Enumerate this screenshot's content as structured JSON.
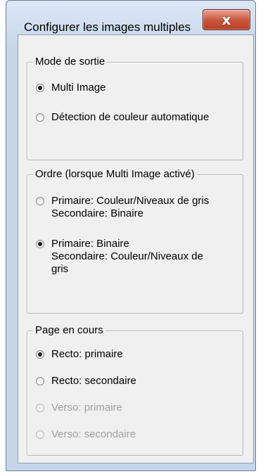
{
  "window": {
    "title": "Configurer les images multiples",
    "close_icon": "x"
  },
  "output_mode": {
    "legend": "Mode de sortie",
    "options": [
      {
        "label": "Multi Image",
        "checked": true,
        "disabled": false
      },
      {
        "label": "Détection de couleur automatique",
        "checked": false,
        "disabled": false
      }
    ]
  },
  "order": {
    "legend": "Ordre (lorsque Multi Image activé)",
    "options": [
      {
        "line1": "Primaire: Couleur/Niveaux de gris",
        "line2": "Secondaire: Binaire",
        "checked": false,
        "disabled": false
      },
      {
        "line1": "Primaire: Binaire",
        "line2": "Secondaire: Couleur/Niveaux de",
        "line3": "gris",
        "checked": true,
        "disabled": false
      }
    ]
  },
  "current_page": {
    "legend": "Page en cours",
    "options": [
      {
        "label": "Recto: primaire",
        "checked": true,
        "disabled": false
      },
      {
        "label": "Recto: secondaire",
        "checked": false,
        "disabled": false
      },
      {
        "label": "Verso: primaire",
        "checked": false,
        "disabled": true
      },
      {
        "label": "Verso: secondaire",
        "checked": false,
        "disabled": true
      }
    ]
  }
}
